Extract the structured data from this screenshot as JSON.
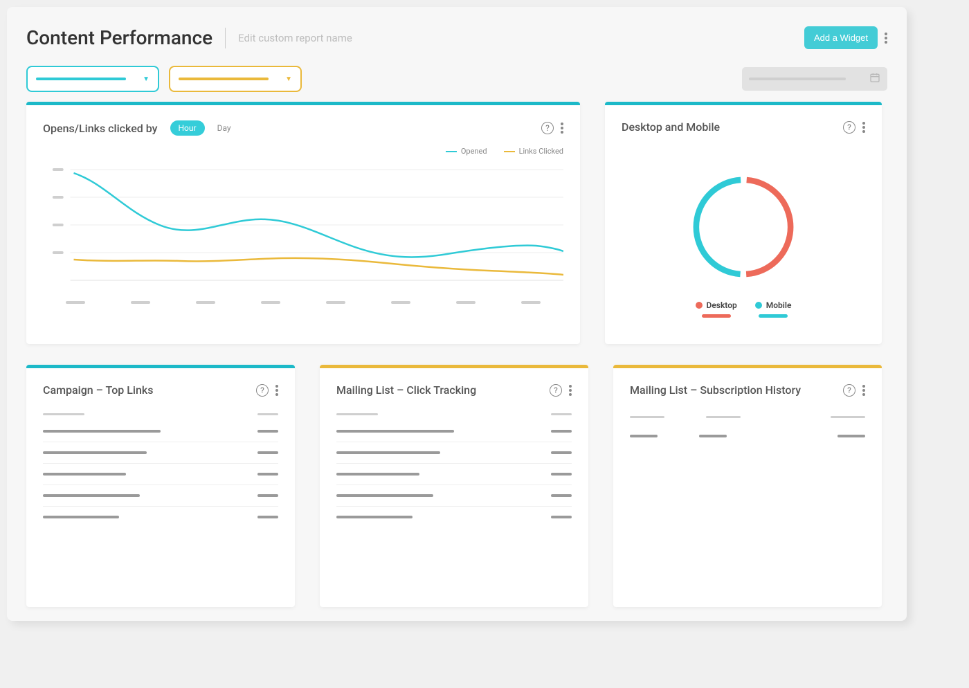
{
  "header": {
    "title": "Content Performance",
    "edit_placeholder": "Edit custom report name",
    "add_widget_label": "Add a Widget"
  },
  "panels": {
    "opens_links": {
      "title": "Opens/Links clicked by",
      "toggle_hour": "Hour",
      "toggle_day": "Day",
      "legend_opened": "Opened",
      "legend_links": "Links Clicked"
    },
    "desktop_mobile": {
      "title": "Desktop and Mobile",
      "legend_desktop": "Desktop",
      "legend_mobile": "Mobile"
    },
    "top_links": {
      "title": "Campaign – Top Links"
    },
    "click_tracking": {
      "title": "Mailing List – Click Tracking"
    },
    "sub_history": {
      "title": "Mailing List – Subscription History"
    }
  },
  "colors": {
    "teal": "#2fcad6",
    "yellow": "#eab93b",
    "red": "#ed6a5a"
  },
  "chart_data": [
    {
      "id": "opens_links_by_hour",
      "type": "line",
      "title": "Opens/Links clicked by Hour",
      "x_points": 8,
      "ylim": [
        0,
        100
      ],
      "series": [
        {
          "name": "Opened",
          "color": "#2fcad6",
          "values": [
            92,
            70,
            50,
            55,
            58,
            47,
            38,
            32,
            29,
            33,
            37,
            38,
            36,
            33,
            32
          ]
        },
        {
          "name": "Links Clicked",
          "color": "#eab93b",
          "values": [
            24,
            22,
            23,
            22,
            24,
            25,
            26,
            25,
            25,
            23,
            20,
            18,
            17,
            16,
            15
          ]
        }
      ]
    },
    {
      "id": "desktop_mobile",
      "type": "pie",
      "title": "Desktop and Mobile",
      "series": [
        {
          "name": "Desktop",
          "color": "#ed6a5a",
          "value": 50
        },
        {
          "name": "Mobile",
          "color": "#2fcad6",
          "value": 50
        }
      ]
    }
  ]
}
